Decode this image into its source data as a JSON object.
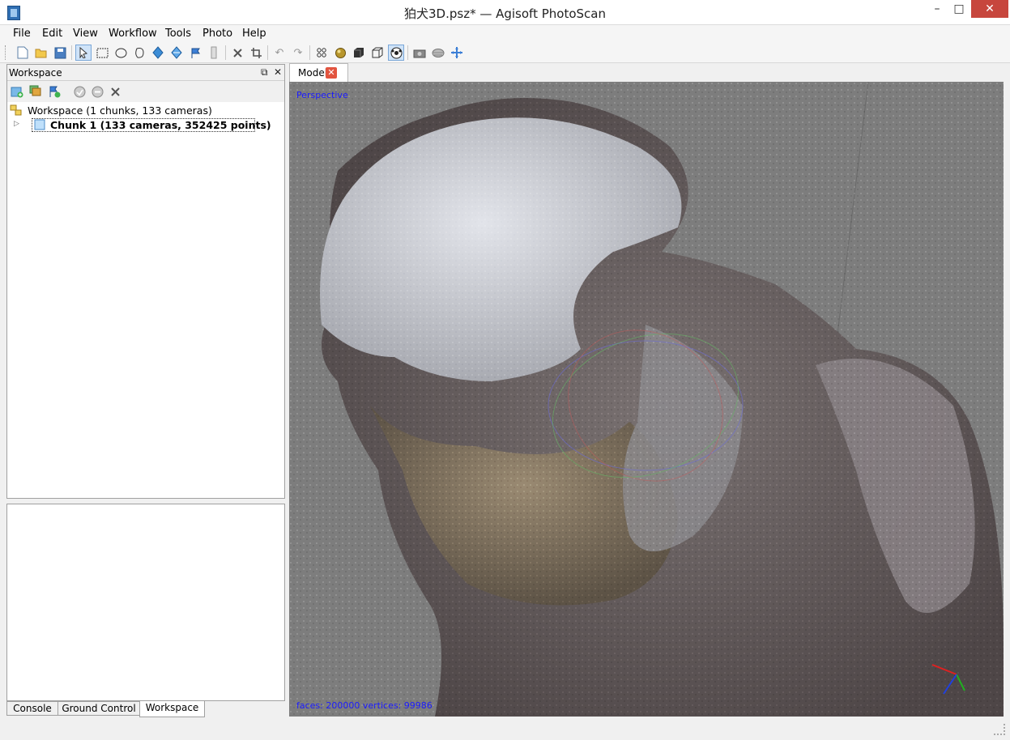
{
  "window": {
    "title": "狛犬3D.psz* — Agisoft PhotoScan"
  },
  "menu": [
    "File",
    "Edit",
    "View",
    "Workflow",
    "Tools",
    "Photo",
    "Help"
  ],
  "toolbar": {
    "icons": [
      "new-icon",
      "open-icon",
      "save-icon",
      "navigation-icon",
      "rectangle-selection-icon",
      "circle-selection-icon",
      "free-form-selection-icon",
      "move-region-icon",
      "rotate-region-icon",
      "place-marker-icon",
      "ruler-icon",
      "delete-selection-icon",
      "crop-selection-icon",
      "undo-icon",
      "redo-icon",
      "point-cloud-icon",
      "shaded-icon",
      "solid-icon",
      "wireframe-icon",
      "textured-icon",
      "show-cameras-icon",
      "show-region-icon",
      "reset-view-icon"
    ]
  },
  "workspace": {
    "panel_title": "Workspace",
    "root_label": "Workspace (1 chunks, 133 cameras)",
    "chunk_label": "Chunk 1 (133 cameras, 352425 points)"
  },
  "bottom_tabs": [
    "Console",
    "Ground Control",
    "Workspace"
  ],
  "model_tab": {
    "label": "Model"
  },
  "viewport": {
    "projection": "Perspective",
    "stats": "faces: 200000 vertices: 99986"
  },
  "colors": {
    "viewport_bg": "#7d7d7d",
    "overlay_text": "#1a1aff",
    "selection": "#cfe3f8"
  }
}
